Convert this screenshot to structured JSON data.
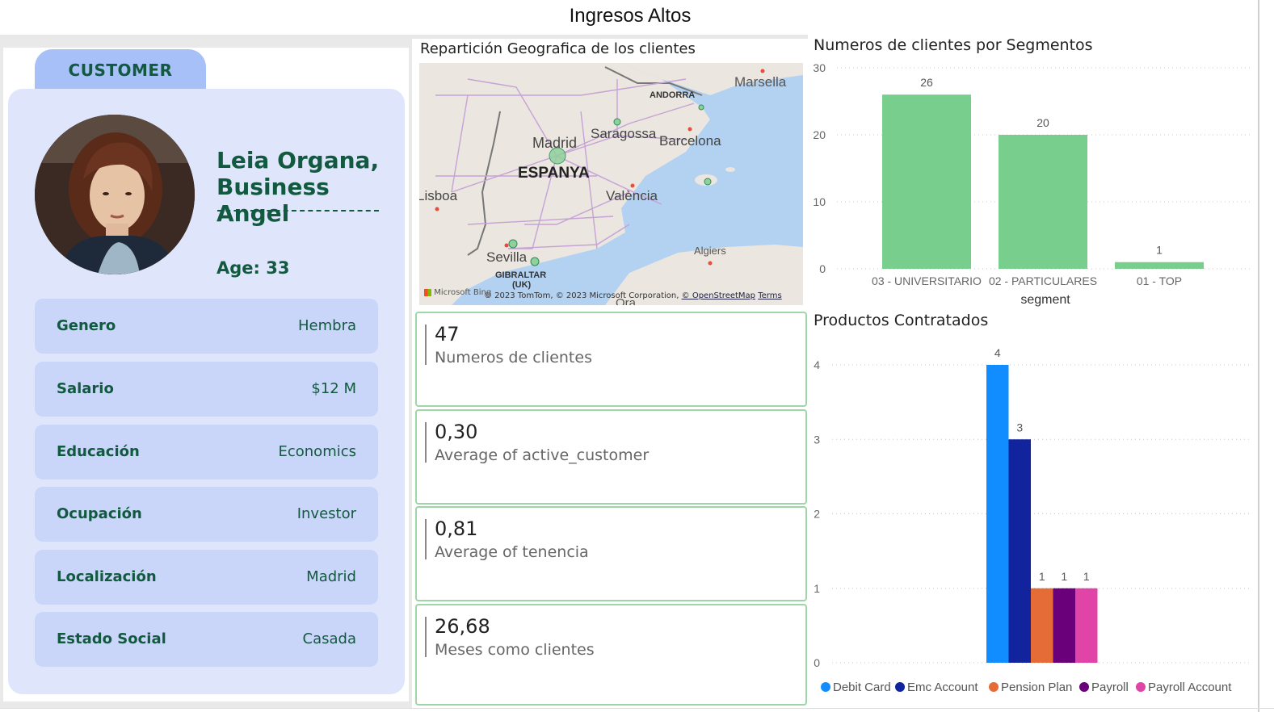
{
  "page": {
    "title": "Ingresos Altos"
  },
  "customer": {
    "tab_label": "CUSTOMER",
    "name_line1": "Leia Organa,",
    "name_line2": "Business Angel",
    "age_text": "Age: 33",
    "fields": [
      {
        "label": "Genero",
        "value": "Hembra"
      },
      {
        "label": "Salario",
        "value": "$12 M"
      },
      {
        "label": "Educación",
        "value": "Economics"
      },
      {
        "label": "Ocupación",
        "value": "Investor"
      },
      {
        "label": "Localización",
        "value": "Madrid"
      },
      {
        "label": "Estado Social",
        "value": "Casada"
      }
    ]
  },
  "map": {
    "title": "Repartición Geografica de los clientes",
    "places": {
      "marsella": "Marsella",
      "andorra": "ANDORRA",
      "madrid": "Madrid",
      "saragossa": "Saragossa",
      "barcelona": "Barcelona",
      "espanya": "ESPANYA",
      "lisboa": "Lisboa",
      "valencia": "València",
      "sevilla": "Sevilla",
      "gibraltar": "GIBRALTAR",
      "uk": "(UK)",
      "algiers": "Algiers",
      "ora": "Ora"
    },
    "attribution_logo": "Microsoft Bing",
    "attribution_text": "© 2023 TomTom, © 2023 Microsoft Corporation,",
    "attribution_osm": "© OpenStreetMap",
    "attribution_terms": "Terms"
  },
  "kpis": [
    {
      "value": "47",
      "label": "Numeros de clientes"
    },
    {
      "value": "0,30",
      "label": "Average of active_customer"
    },
    {
      "value": "0,81",
      "label": "Average of tenencia"
    },
    {
      "value": "26,68",
      "label": "Meses como clientes"
    }
  ],
  "colors": {
    "segment_bar": "#78cf8d",
    "debit_card": "#118dff",
    "emc_account": "#12239e",
    "pension_plan": "#e66c37",
    "payroll": "#6b007b",
    "payroll_account": "#e044a7"
  },
  "chart_data": [
    {
      "type": "bar",
      "title": "Numeros de clientes por Segmentos",
      "xlabel": "segment",
      "ylabel": "",
      "categories": [
        "03 - UNIVERSITARIO",
        "02 - PARTICULARES",
        "01 - TOP"
      ],
      "values": [
        26,
        20,
        1
      ],
      "yticks": [
        0,
        10,
        20,
        30
      ],
      "ylim": [
        0,
        30
      ],
      "data_labels": true,
      "grid": true
    },
    {
      "type": "bar",
      "title": "Productos Contratados",
      "xlabel": "",
      "ylabel": "",
      "series": [
        {
          "name": "Debit Card",
          "values": [
            4
          ]
        },
        {
          "name": "Emc Account",
          "values": [
            3
          ]
        },
        {
          "name": "Pension Plan",
          "values": [
            1
          ]
        },
        {
          "name": "Payroll",
          "values": [
            1
          ]
        },
        {
          "name": "Payroll Account",
          "values": [
            1
          ]
        }
      ],
      "yticks": [
        0,
        1,
        2,
        3,
        4
      ],
      "ylim": [
        0,
        4
      ],
      "data_labels": true,
      "grid": true,
      "legend": "bottom"
    }
  ]
}
